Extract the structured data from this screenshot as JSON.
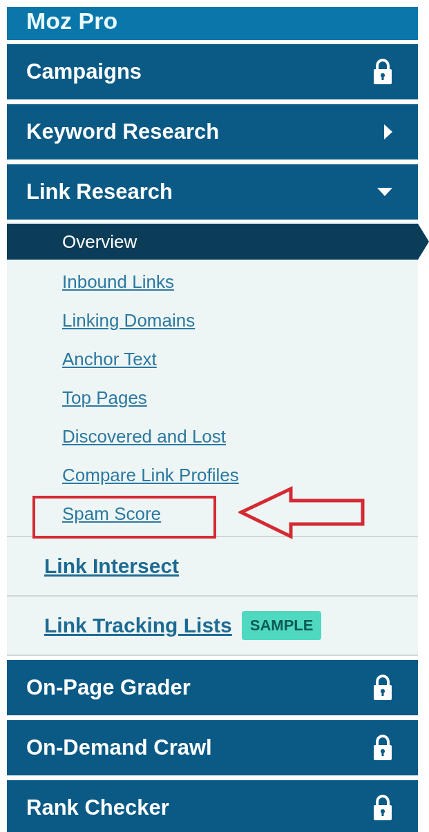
{
  "header": {
    "title": "Moz Pro"
  },
  "menu_top": [
    {
      "label": "Campaigns",
      "kind": "locked"
    },
    {
      "label": "Keyword Research",
      "kind": "expandable",
      "expanded": false
    },
    {
      "label": "Link Research",
      "kind": "expandable",
      "expanded": true
    }
  ],
  "submenu": [
    {
      "label": "Overview",
      "selected": true,
      "marked": false
    },
    {
      "label": "Inbound Links",
      "selected": false,
      "marked": false
    },
    {
      "label": "Linking Domains",
      "selected": false,
      "marked": false
    },
    {
      "label": "Anchor Text",
      "selected": false,
      "marked": false
    },
    {
      "label": "Top Pages",
      "selected": false,
      "marked": false
    },
    {
      "label": "Discovered and Lost",
      "selected": false,
      "marked": false
    },
    {
      "label": "Compare Link Profiles",
      "selected": false,
      "marked": false
    },
    {
      "label": "Spam Score",
      "selected": false,
      "marked": true
    }
  ],
  "secondary_links": [
    {
      "label": "Link Intersect"
    },
    {
      "label": "Link Tracking Lists",
      "badge": "SAMPLE"
    }
  ],
  "menu_bottom": [
    {
      "label": "On-Page Grader",
      "kind": "locked"
    },
    {
      "label": "On-Demand Crawl",
      "kind": "locked"
    },
    {
      "label": "Rank Checker",
      "kind": "locked"
    }
  ]
}
